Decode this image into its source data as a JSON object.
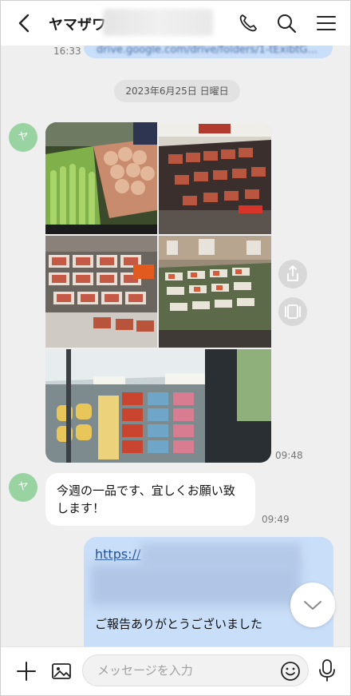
{
  "header": {
    "chat_name": "ヤマザワ",
    "icons": [
      "back-icon",
      "phone-icon",
      "search-icon",
      "menu-icon"
    ]
  },
  "messages": {
    "top_link_fragment": "drive.google.com/drive/folders/1-tExibtG...",
    "top_time": "16:33",
    "date_separator": "2023年6月25日 日曜日",
    "avatar_initial": "ヤ",
    "photo_time": "09:48",
    "text_message": "今週の一品です、宜しくお願い致します！",
    "text_time": "09:49",
    "my_link": "https://",
    "my_text": "ご報告ありがとうございました"
  },
  "input": {
    "placeholder": "メッセージを入力"
  },
  "colors": {
    "chat_bg": "#efefef",
    "my_bubble": "#c9def8",
    "avatar": "#9ad3a2",
    "link": "#1f4fa0"
  }
}
